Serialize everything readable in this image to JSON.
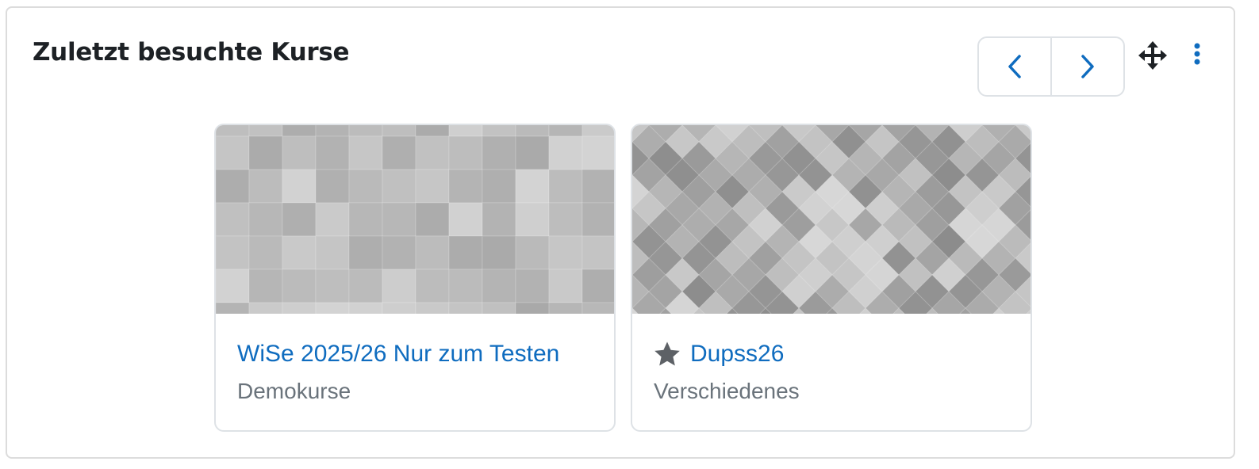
{
  "block": {
    "title": "Zuletzt besuchte Kurse",
    "prev_icon": "chevron-left-icon",
    "next_icon": "chevron-right-icon",
    "move_icon": "move-arrows-icon",
    "menu_icon": "vertical-dots-icon"
  },
  "courses": [
    {
      "title": "WiSe 2025/26 Nur zum Testen",
      "category": "Demokurse",
      "starred": false,
      "pattern": "squares"
    },
    {
      "title": "Dupss26",
      "category": "Verschiedenes",
      "starred": true,
      "pattern": "diamonds",
      "star_icon": "star-icon"
    }
  ],
  "colors": {
    "link": "#0f6cbf",
    "muted": "#6a737b",
    "title": "#1d2125",
    "border": "#dee2e6",
    "star": "#5d6166"
  }
}
